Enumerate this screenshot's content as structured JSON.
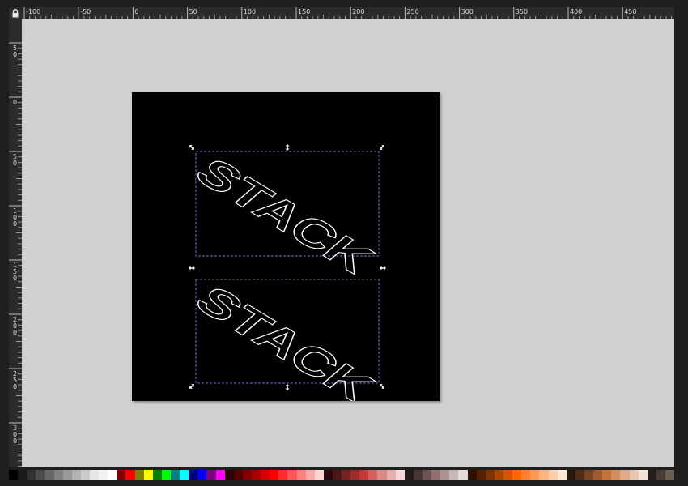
{
  "rulers": {
    "horizontal_labels": [
      "-100",
      "-50",
      "0",
      "50",
      "100",
      "150",
      "200",
      "250",
      "300",
      "350",
      "400",
      "450"
    ],
    "vertical_labels": [
      "5 0",
      "0",
      "5 0",
      "1 0 0",
      "1 5 0",
      "2 0 0",
      "2 5 0",
      "3 0 0"
    ]
  },
  "canvas": {
    "background": "#d1d0ce",
    "page_color": "#000000",
    "objects": [
      {
        "type": "text-outline",
        "text": "STACK",
        "stroke": "#ffffff"
      },
      {
        "type": "text-outline",
        "text": "STACK",
        "stroke": "#ffffff"
      }
    ],
    "selection_color": "#6e6ec8"
  },
  "palette": {
    "swatches": [
      "#000000",
      "#1a1a1a",
      "#333333",
      "#4d4d4d",
      "#666666",
      "#808080",
      "#999999",
      "#b3b3b3",
      "#cccccc",
      "#e6e6e6",
      "#f2f2f2",
      "#ffffff",
      "#800000",
      "#ff0000",
      "#808000",
      "#ffff00",
      "#008000",
      "#00ff00",
      "#008080",
      "#00ffff",
      "#000080",
      "#0000ff",
      "#800080",
      "#ff00ff",
      "#2b0000",
      "#550000",
      "#800000",
      "#aa0000",
      "#d40000",
      "#ff0000",
      "#ff2a2a",
      "#ff5555",
      "#ff8080",
      "#ffaaaa",
      "#ffd5d5",
      "#280b0b",
      "#501616",
      "#782121",
      "#a02c2c",
      "#c83737",
      "#d35f5f",
      "#de8787",
      "#e9afaf",
      "#f4d7d7",
      "#241c1c",
      "#483737",
      "#6c5353",
      "#916f6f",
      "#ac9393",
      "#c8b7b7",
      "#e3dbdb",
      "#2b1100",
      "#552200",
      "#803300",
      "#aa4400",
      "#d45500",
      "#ff6600",
      "#ff7f2a",
      "#ff9955",
      "#ffb380",
      "#ffccaa",
      "#ffe6d5",
      "#28170b",
      "#502d16",
      "#784421",
      "#a05a2c",
      "#c87137",
      "#d38d5f",
      "#deaa87",
      "#e9c6af",
      "#f4e3d7",
      "#241f1c",
      "#483e37",
      "#6c5d53"
    ]
  }
}
